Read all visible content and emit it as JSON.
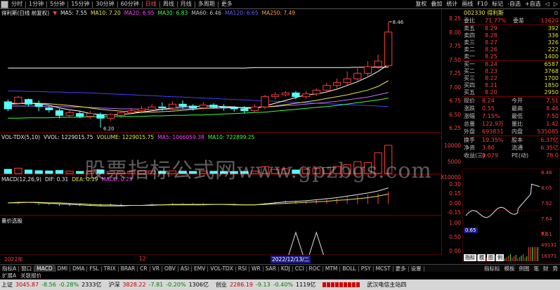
{
  "toolbar": {
    "left_items": [
      "分时",
      "1分钟",
      "5分钟",
      "15分钟",
      "30分钟",
      "60分钟",
      "日线",
      "周线",
      "月线",
      "多周期",
      "更多"
    ],
    "selected": "日线",
    "right_items": [
      "复权",
      "叠加",
      "统计",
      "画线",
      "F10",
      "标记",
      "-自选",
      "+自选",
      "◁",
      "▷"
    ]
  },
  "main_legend": {
    "title": "得利斯(日线 前复权)",
    "ma5": "MA5: 7.55",
    "ma10": "MA10: 7.20",
    "ma20": "MA20: 6.95",
    "ma30": "MA30: 6.83",
    "ma60": "MA60: 6.46",
    "ma120": "MA120: 6.65",
    "ma250": "MA250: 7.49"
  },
  "annotations": {
    "high": "8.46",
    "low": "6.20"
  },
  "vol_legend": {
    "name": "VOL-TDX(5,10)",
    "vvol": "VVOL: 1229015.75",
    "volume": "VOLUME: 1229015.75",
    "ma5": "MA5: 1066059.38",
    "ma10": "MA10: 722899.25"
  },
  "macd_legend": {
    "name": "MACD(12,26,9)",
    "dif": "DIF: 0.31",
    "dea": "DEA: 0.19",
    "macd": "MACD: 0.23"
  },
  "signal_legend": {
    "name": "量价选股"
  },
  "price_axis": [
    "8.25",
    "8.00",
    "7.75",
    "7.50",
    "7.25",
    "7.00",
    "6.75",
    "6.50",
    "6.25"
  ],
  "vol_axis": [
    "10000",
    "5000",
    "X10000"
  ],
  "macd_axis": [
    "0.30",
    "0.15",
    "0.00",
    "-0.15"
  ],
  "signal_axis": [
    "1.00",
    "0.50",
    "0.00"
  ],
  "dates": {
    "left": "2022年",
    "mid": "12",
    "cursor": "2022/12/13/二"
  },
  "quote": {
    "code": "002330",
    "name": "得利斯",
    "weibi_label": "委比",
    "weibi_value": "71.77%",
    "weicha_label": "委差",
    "weicha_value": "13620",
    "asks": [
      {
        "label": "卖五",
        "price": "8.29",
        "vol": "392"
      },
      {
        "label": "卖四",
        "price": "8.28",
        "vol": "336"
      },
      {
        "label": "卖三",
        "price": "8.27",
        "vol": "326"
      },
      {
        "label": "卖二",
        "price": "8.26",
        "vol": "222"
      },
      {
        "label": "卖一",
        "price": "8.25",
        "vol": "1400"
      }
    ],
    "bids": [
      {
        "label": "买一",
        "price": "8.24",
        "vol": "6587"
      },
      {
        "label": "买二",
        "price": "8.23",
        "vol": "3768"
      },
      {
        "label": "买三",
        "price": "8.22",
        "vol": "1700"
      },
      {
        "label": "买四",
        "price": "8.21",
        "vol": "1850"
      },
      {
        "label": "买五",
        "price": "8.20",
        "vol": "2950"
      }
    ],
    "stats": [
      {
        "l1": "现价",
        "v1": "8.24",
        "l2": "今开",
        "v2": "7.51"
      },
      {
        "l1": "涨跌",
        "v1": "0.55",
        "l2": "最高",
        "v2": "8.46"
      },
      {
        "l1": "涨幅",
        "v1": "7.15%",
        "l2": "最低",
        "v2": "7.50"
      },
      {
        "l1": "总量",
        "v1": "122.9万",
        "l2": "量比",
        "v2": "1.42"
      },
      {
        "l1": "外盘",
        "v1": "693831",
        "l2": "内盘",
        "v2": "535085"
      }
    ],
    "stats2": [
      {
        "l1": "换手",
        "v1": "19.35%",
        "l2": "股本",
        "v2": "6.37亿"
      },
      {
        "l1": "净资",
        "v1": "3.80",
        "l2": "流通",
        "v2": "6.35亿"
      },
      {
        "l1": "收益(三)",
        "v1": "0.079",
        "l2": "PE(动)",
        "v2": "78.0"
      }
    ]
  },
  "mini_chart": {
    "axis": [
      "8.46",
      "8.05",
      "7.92",
      "7.64",
      "7.51"
    ],
    "label": "0.65",
    "vol_axis": [
      "61",
      "49131",
      "16371"
    ],
    "tabs": [
      "指标",
      "模",
      "图",
      "例"
    ]
  },
  "bottom_tabs": [
    "指标A",
    "窗口",
    "MACD",
    "DMI",
    "DMA",
    "FSL",
    "TRIX",
    "BRAR",
    "CR",
    "VR",
    "OBV",
    "ASI",
    "EMV",
    "VOL-TDX",
    "RSI",
    "WR",
    "SAR",
    "KDJ",
    "CCI",
    "ROC",
    "MTM",
    "BOLL",
    "PSY",
    "MCST",
    "更多",
    "设置"
  ],
  "bottom_tabs_right": [
    "指标标",
    "模板",
    "例图",
    "笔",
    "财",
    "势"
  ],
  "ticker": {
    "label1": "扩展A",
    "label2": "关联报价",
    "item": "武汉电信主站四"
  },
  "status_bar": {
    "sh_label": "上证",
    "sh_value": "3045.87",
    "sh_change": "-8.56",
    "sh_pct": "-0.28%",
    "sh_amt": "2333亿",
    "hs_label": "沪深",
    "hs_value": "3828.22",
    "hs_change": "-7.81",
    "hs_pct": "-0.20%",
    "hs_amt": "1306亿",
    "cy_label": "创业",
    "cy_value": "2286.19",
    "cy_change": "-9.13",
    "cy_pct": "-0.40%",
    "cy_amt": "1119亿"
  },
  "watermark": "股票指标公式网www.gpzbgs.com",
  "colors": {
    "up": "#ff3c3c",
    "down": "#54ffff",
    "ma5": "#ffffff",
    "ma10": "#e8e840",
    "ma20": "#ff40ff",
    "ma30": "#3cff3c",
    "ma60": "#c0c0c0",
    "ma120": "#4040ff",
    "ma250": "#ffa040"
  },
  "chart_data": [
    {
      "type": "candlestick",
      "title": "得利斯(日线 前复权)",
      "ylim": [
        6.15,
        8.55
      ],
      "candles": [
        {
          "o": 6.75,
          "c": 6.6,
          "h": 6.8,
          "l": 6.55
        },
        {
          "o": 6.72,
          "c": 6.85,
          "h": 6.88,
          "l": 6.7
        },
        {
          "o": 6.8,
          "c": 6.7,
          "h": 6.82,
          "l": 6.65
        },
        {
          "o": 6.7,
          "c": 6.65,
          "h": 6.78,
          "l": 6.55
        },
        {
          "o": 6.62,
          "c": 6.58,
          "h": 6.66,
          "l": 6.52
        },
        {
          "o": 6.56,
          "c": 6.46,
          "h": 6.6,
          "l": 6.4
        },
        {
          "o": 6.46,
          "c": 6.52,
          "h": 6.58,
          "l": 6.42
        },
        {
          "o": 6.5,
          "c": 6.44,
          "h": 6.55,
          "l": 6.4
        },
        {
          "o": 6.44,
          "c": 6.5,
          "h": 6.56,
          "l": 6.38
        },
        {
          "o": 6.48,
          "c": 6.4,
          "h": 6.52,
          "l": 6.2
        },
        {
          "o": 6.4,
          "c": 6.48,
          "h": 6.5,
          "l": 6.34
        },
        {
          "o": 6.46,
          "c": 6.52,
          "h": 6.56,
          "l": 6.4
        },
        {
          "o": 6.52,
          "c": 6.56,
          "h": 6.62,
          "l": 6.48
        },
        {
          "o": 6.56,
          "c": 6.6,
          "h": 6.66,
          "l": 6.5
        },
        {
          "o": 6.58,
          "c": 6.64,
          "h": 6.7,
          "l": 6.55
        },
        {
          "o": 6.64,
          "c": 6.62,
          "h": 6.74,
          "l": 6.56
        },
        {
          "o": 6.62,
          "c": 6.7,
          "h": 6.76,
          "l": 6.58
        },
        {
          "o": 6.7,
          "c": 6.66,
          "h": 6.78,
          "l": 6.6
        },
        {
          "o": 6.66,
          "c": 6.62,
          "h": 6.7,
          "l": 6.56
        },
        {
          "o": 6.62,
          "c": 6.68,
          "h": 6.74,
          "l": 6.58
        },
        {
          "o": 6.68,
          "c": 6.64,
          "h": 6.72,
          "l": 6.6
        },
        {
          "o": 6.64,
          "c": 6.62,
          "h": 6.7,
          "l": 6.56
        },
        {
          "o": 6.62,
          "c": 6.6,
          "h": 6.66,
          "l": 6.54
        },
        {
          "o": 6.6,
          "c": 6.56,
          "h": 6.66,
          "l": 6.5
        },
        {
          "o": 6.56,
          "c": 6.64,
          "h": 6.7,
          "l": 6.52
        },
        {
          "o": 6.64,
          "c": 6.86,
          "h": 6.9,
          "l": 6.6
        },
        {
          "o": 6.86,
          "c": 6.9,
          "h": 6.96,
          "l": 6.8
        },
        {
          "o": 6.9,
          "c": 6.94,
          "h": 6.98,
          "l": 6.86
        },
        {
          "o": 6.94,
          "c": 6.86,
          "h": 6.98,
          "l": 6.8
        },
        {
          "o": 6.86,
          "c": 6.92,
          "h": 6.98,
          "l": 6.82
        },
        {
          "o": 6.92,
          "c": 7.0,
          "h": 7.04,
          "l": 6.88
        },
        {
          "o": 7.0,
          "c": 7.1,
          "h": 7.16,
          "l": 6.96
        },
        {
          "o": 7.1,
          "c": 7.16,
          "h": 7.25,
          "l": 7.04
        },
        {
          "o": 7.16,
          "c": 7.24,
          "h": 7.4,
          "l": 7.1
        },
        {
          "o": 7.24,
          "c": 7.36,
          "h": 7.5,
          "l": 7.2
        },
        {
          "o": 7.36,
          "c": 7.5,
          "h": 7.62,
          "l": 7.3
        },
        {
          "o": 7.5,
          "c": 7.62,
          "h": 7.76,
          "l": 7.46
        },
        {
          "o": 7.52,
          "c": 8.24,
          "h": 8.46,
          "l": 7.5
        }
      ],
      "ma5": [
        6.7,
        6.71,
        6.72,
        6.71,
        6.68,
        6.62,
        6.58,
        6.55,
        6.5,
        6.48,
        6.47,
        6.48,
        6.5,
        6.53,
        6.56,
        6.59,
        6.62,
        6.64,
        6.65,
        6.66,
        6.66,
        6.65,
        6.64,
        6.62,
        6.61,
        6.66,
        6.72,
        6.78,
        6.84,
        6.9,
        6.92,
        6.96,
        7.02,
        7.1,
        7.18,
        7.28,
        7.4,
        7.55
      ],
      "ma10": [
        6.72,
        6.72,
        6.72,
        6.72,
        6.71,
        6.69,
        6.67,
        6.65,
        6.62,
        6.59,
        6.57,
        6.55,
        6.54,
        6.53,
        6.53,
        6.54,
        6.55,
        6.57,
        6.59,
        6.61,
        6.62,
        6.63,
        6.63,
        6.63,
        6.63,
        6.64,
        6.66,
        6.69,
        6.72,
        6.75,
        6.78,
        6.82,
        6.86,
        6.9,
        6.95,
        7.0,
        7.08,
        7.2
      ],
      "ma20": [
        6.66,
        6.66,
        6.66,
        6.66,
        6.65,
        6.65,
        6.64,
        6.64,
        6.63,
        6.62,
        6.61,
        6.6,
        6.6,
        6.59,
        6.59,
        6.59,
        6.59,
        6.6,
        6.6,
        6.61,
        6.61,
        6.62,
        6.62,
        6.63,
        6.63,
        6.64,
        6.65,
        6.67,
        6.68,
        6.7,
        6.72,
        6.74,
        6.76,
        6.79,
        6.82,
        6.85,
        6.9,
        6.95
      ],
      "ma30": [
        6.4,
        6.4,
        6.41,
        6.41,
        6.41,
        6.42,
        6.42,
        6.42,
        6.43,
        6.43,
        6.43,
        6.44,
        6.44,
        6.44,
        6.45,
        6.45,
        6.46,
        6.46,
        6.47,
        6.47,
        6.48,
        6.49,
        6.5,
        6.51,
        6.52,
        6.53,
        6.55,
        6.57,
        6.59,
        6.61,
        6.63,
        6.65,
        6.67,
        6.7,
        6.73,
        6.76,
        6.79,
        6.83
      ],
      "ma120": [
        6.98,
        6.98,
        6.97,
        6.97,
        6.96,
        6.96,
        6.95,
        6.95,
        6.94,
        6.93,
        6.92,
        6.91,
        6.9,
        6.89,
        6.88,
        6.87,
        6.86,
        6.85,
        6.84,
        6.83,
        6.82,
        6.81,
        6.8,
        6.79,
        6.78,
        6.77,
        6.76,
        6.75,
        6.74,
        6.73,
        6.72,
        6.71,
        6.7,
        6.69,
        6.68,
        6.67,
        6.66,
        6.65
      ],
      "ma250": [
        7.47,
        7.47,
        7.47,
        7.47,
        7.47,
        7.47,
        7.47,
        7.47,
        7.47,
        7.47,
        7.47,
        7.47,
        7.47,
        7.47,
        7.47,
        7.47,
        7.47,
        7.47,
        7.47,
        7.47,
        7.47,
        7.47,
        7.47,
        7.47,
        7.48,
        7.48,
        7.48,
        7.48,
        7.48,
        7.48,
        7.48,
        7.48,
        7.48,
        7.48,
        7.49,
        7.49,
        7.49,
        7.49
      ]
    },
    {
      "type": "bar",
      "title": "VOL-TDX(5,10)",
      "ylim": [
        0,
        1350000
      ],
      "values": [
        180000,
        230000,
        150000,
        120000,
        110000,
        130000,
        100000,
        90000,
        110000,
        150000,
        95000,
        90000,
        100000,
        105000,
        110000,
        95000,
        110000,
        98000,
        90000,
        100000,
        95000,
        90000,
        85000,
        90000,
        100000,
        300000,
        180000,
        200000,
        150000,
        190000,
        220000,
        260000,
        300000,
        380000,
        520000,
        480000,
        900000,
        1229015.75
      ],
      "up": [
        false,
        true,
        false,
        false,
        false,
        false,
        true,
        false,
        true,
        false,
        true,
        true,
        true,
        true,
        true,
        false,
        true,
        false,
        false,
        true,
        false,
        false,
        false,
        false,
        true,
        true,
        true,
        true,
        false,
        true,
        true,
        true,
        true,
        true,
        true,
        true,
        true,
        true
      ]
    },
    {
      "type": "line",
      "title": "MACD(12,26,9)",
      "ylim": [
        -0.2,
        0.4
      ],
      "dif": [
        0.02,
        0.03,
        0.03,
        0.02,
        0.01,
        0.0,
        -0.01,
        -0.02,
        -0.03,
        -0.04,
        -0.04,
        -0.04,
        -0.03,
        -0.03,
        -0.02,
        -0.02,
        -0.01,
        -0.01,
        -0.01,
        -0.01,
        -0.01,
        -0.01,
        -0.02,
        -0.02,
        -0.02,
        0.0,
        0.02,
        0.04,
        0.05,
        0.06,
        0.08,
        0.1,
        0.12,
        0.15,
        0.18,
        0.21,
        0.25,
        0.31
      ],
      "dea": [
        0.02,
        0.02,
        0.03,
        0.03,
        0.02,
        0.02,
        0.01,
        0.0,
        -0.01,
        -0.02,
        -0.02,
        -0.03,
        -0.03,
        -0.03,
        -0.03,
        -0.02,
        -0.02,
        -0.02,
        -0.02,
        -0.02,
        -0.01,
        -0.01,
        -0.01,
        -0.02,
        -0.02,
        -0.01,
        0.0,
        0.01,
        0.02,
        0.03,
        0.04,
        0.05,
        0.07,
        0.08,
        0.1,
        0.12,
        0.15,
        0.19
      ]
    },
    {
      "type": "line",
      "title": "量价选股",
      "ylim": [
        0,
        1
      ],
      "values": [
        0,
        0,
        0,
        0,
        0,
        0,
        0,
        0,
        0,
        0,
        0,
        0,
        0,
        0,
        0,
        0,
        0,
        0,
        0,
        0,
        0,
        0,
        0,
        0,
        0,
        0,
        0,
        0,
        1,
        0,
        1,
        0,
        0,
        0,
        0,
        0,
        0,
        0
      ]
    }
  ]
}
